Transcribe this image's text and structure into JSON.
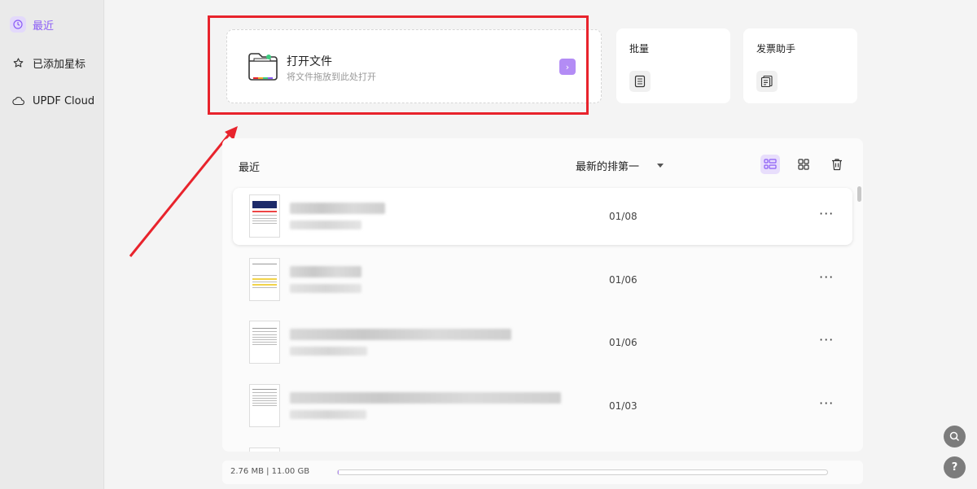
{
  "sidebar": {
    "items": [
      {
        "label": "最近",
        "icon": "clock-icon",
        "active": true
      },
      {
        "label": "已添加星标",
        "icon": "star-icon",
        "active": false
      },
      {
        "label": "UPDF Cloud",
        "icon": "cloud-icon",
        "active": false
      }
    ]
  },
  "open_file": {
    "title": "打开文件",
    "subtitle": "将文件拖放到此处打开",
    "arrow": "›"
  },
  "tools": [
    {
      "label": "批量",
      "icon": "batch-icon"
    },
    {
      "label": "发票助手",
      "icon": "invoice-icon"
    }
  ],
  "recent": {
    "title": "最近",
    "sort_label": "最新的排第一",
    "rows": [
      {
        "date": "01/08",
        "more": "···",
        "selected": true
      },
      {
        "date": "01/06",
        "more": "···",
        "selected": false
      },
      {
        "date": "01/06",
        "more": "···",
        "selected": false
      },
      {
        "date": "01/03",
        "more": "···",
        "selected": false
      }
    ]
  },
  "footer": {
    "storage": "2.76 MB | 11.00 GB",
    "usage_fraction": 0.0003
  },
  "fabs": {
    "search": "search-icon",
    "help": "?"
  },
  "colors": {
    "accent": "#8b5cf6",
    "annotation_red": "#e8232c"
  }
}
